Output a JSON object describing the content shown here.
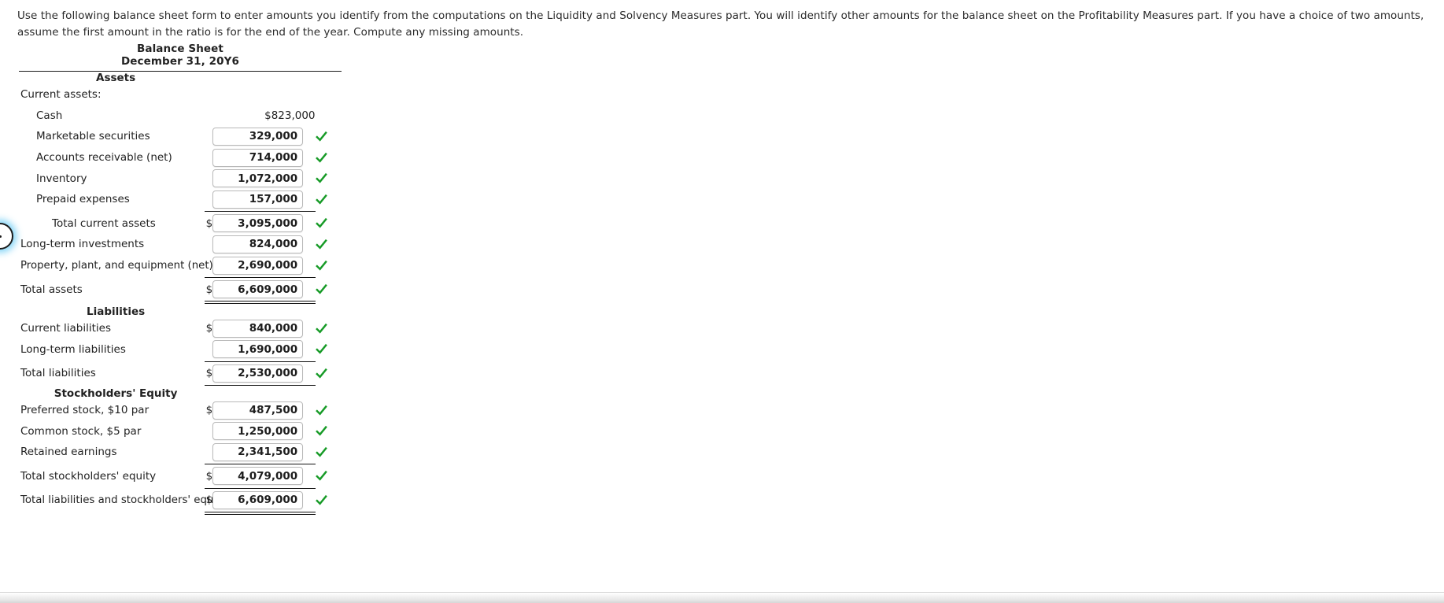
{
  "instructions": {
    "text": "Use the following balance sheet form to enter amounts you identify from the computations on the Liquidity and Solvency Measures part. You will identify other amounts for the balance sheet on the Profitability Measures part. If you have a choice of two amounts, assume the first amount in the ratio is for the end of the year. Compute any missing amounts."
  },
  "balance_sheet": {
    "title": "Balance Sheet",
    "date": "December 31, 20Y6",
    "sections": {
      "assets_heading": "Assets",
      "liabilities_heading": "Liabilities",
      "equity_heading": "Stockholders' Equity"
    },
    "currency_symbol": "$",
    "check_icon": "check-mark",
    "rows": {
      "current_assets_header": "Current assets:",
      "cash": {
        "label": "Cash",
        "value": "$823,000"
      },
      "marketable_securities": {
        "label": "Marketable securities",
        "value": "329,000",
        "status": "correct"
      },
      "accounts_receivable": {
        "label": "Accounts receivable (net)",
        "value": "714,000",
        "status": "correct"
      },
      "inventory": {
        "label": "Inventory",
        "value": "1,072,000",
        "status": "correct"
      },
      "prepaid_expenses": {
        "label": "Prepaid expenses",
        "value": "157,000",
        "status": "correct"
      },
      "total_current_assets": {
        "label": "Total current assets",
        "value": "3,095,000",
        "status": "correct",
        "dollar": "$"
      },
      "long_term_investments": {
        "label": "Long-term investments",
        "value": "824,000",
        "status": "correct"
      },
      "ppe": {
        "label": "Property, plant, and equipment (net)",
        "value": "2,690,000",
        "status": "correct"
      },
      "total_assets": {
        "label": "Total assets",
        "value": "6,609,000",
        "status": "correct",
        "dollar": "$"
      },
      "current_liabilities": {
        "label": "Current liabilities",
        "value": "840,000",
        "status": "correct",
        "dollar": "$"
      },
      "long_term_liabilities": {
        "label": "Long-term liabilities",
        "value": "1,690,000",
        "status": "correct"
      },
      "total_liabilities": {
        "label": "Total liabilities",
        "value": "2,530,000",
        "status": "correct",
        "dollar": "$"
      },
      "preferred_stock": {
        "label": "Preferred stock, $10 par",
        "value": "487,500",
        "status": "correct",
        "dollar": "$"
      },
      "common_stock": {
        "label": "Common stock, $5 par",
        "value": "1,250,000",
        "status": "correct"
      },
      "retained_earnings": {
        "label": "Retained earnings",
        "value": "2,341,500",
        "status": "correct"
      },
      "total_stockholders_equity": {
        "label": "Total stockholders' equity",
        "value": "4,079,000",
        "status": "correct",
        "dollar": "$"
      },
      "total_liabilities_and_equity": {
        "label": "Total liabilities and stockholders' equity",
        "value": "6,609,000",
        "status": "correct",
        "dollar": "$"
      }
    }
  },
  "colors": {
    "check_green": "#179b27",
    "field_border": "#b9b9b9",
    "text": "#222222"
  }
}
